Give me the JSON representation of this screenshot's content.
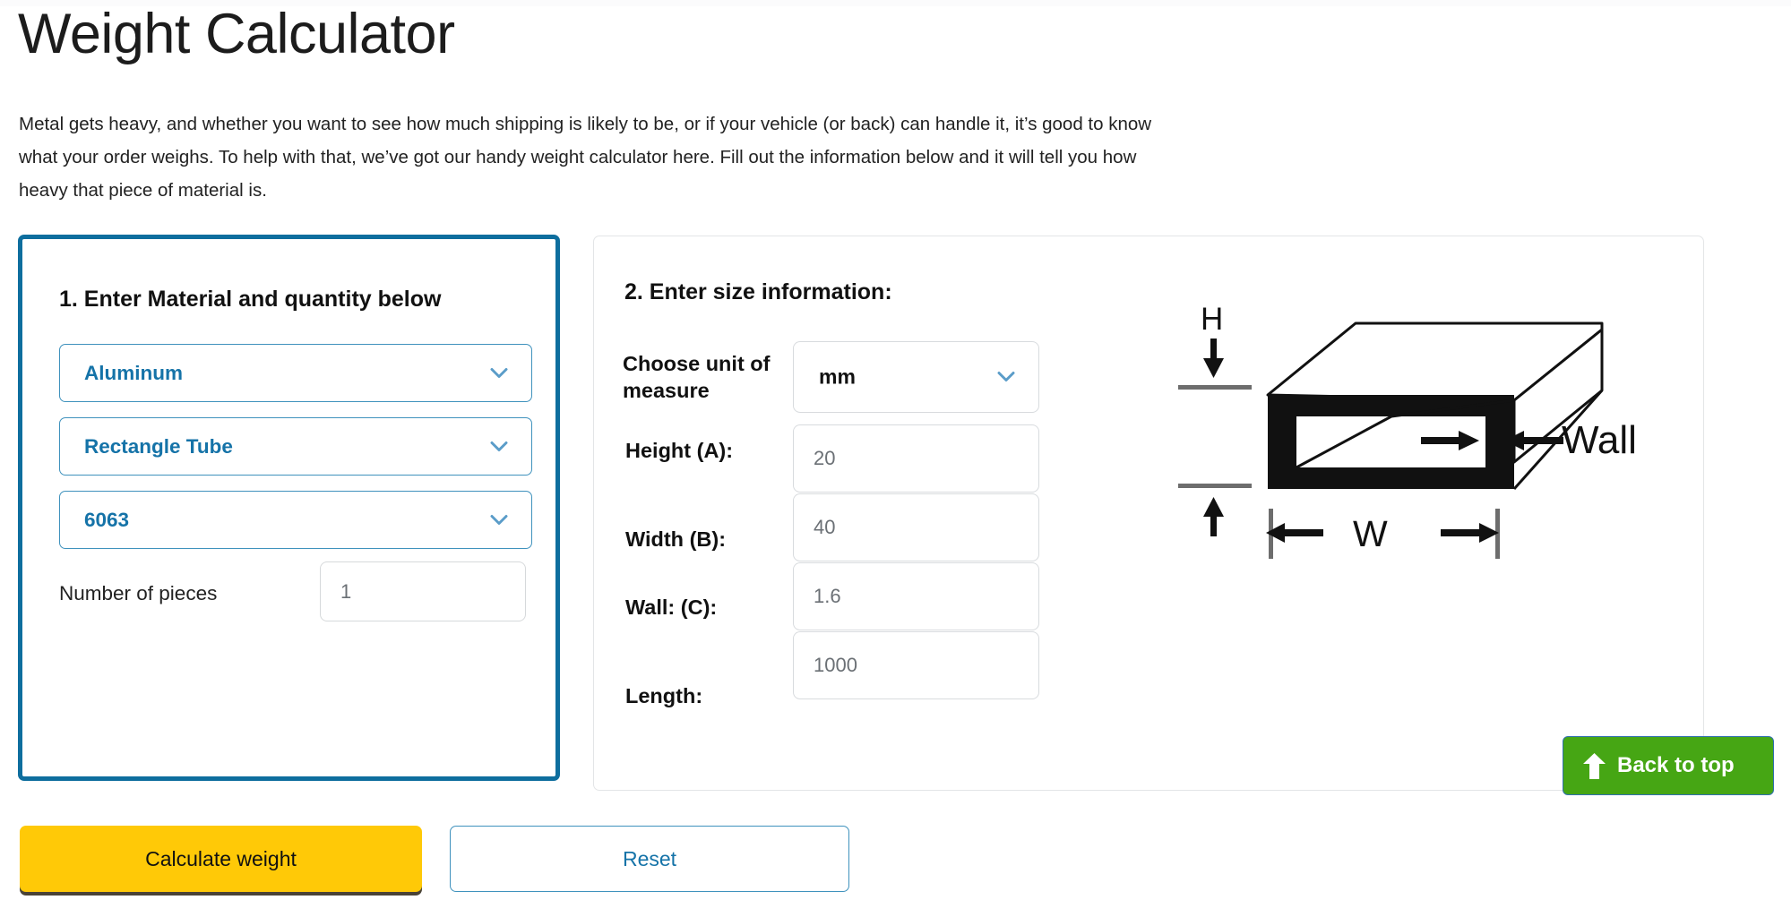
{
  "header": {
    "title": "Weight Calculator",
    "intro": "Metal gets heavy, and whether you want to see how much shipping is likely to be, or if your vehicle (or back) can handle it, it’s good to know what your order weighs. To help with that, we’ve got our handy weight calculator here. Fill out the information below and it will tell you how heavy that piece of material is."
  },
  "material_panel": {
    "title": "1. Enter Material and quantity below",
    "material_select": {
      "label": "Material",
      "value": "Aluminum",
      "icon": "chevron-down-icon"
    },
    "shape_select": {
      "label": "Shape",
      "value": "Rectangle Tube",
      "icon": "chevron-down-icon"
    },
    "grade_select": {
      "label": "Grade",
      "value": "6063",
      "icon": "chevron-down-icon"
    },
    "pieces": {
      "label": "Number of pieces",
      "placeholder": "1",
      "value": ""
    }
  },
  "size_panel": {
    "title": "2. Enter size information:",
    "unit_of_measure": {
      "label": "Choose unit of measure",
      "value": "mm",
      "icon": "chevron-down-icon"
    },
    "fields": [
      {
        "label": "Height (A):",
        "placeholder": "20",
        "value": ""
      },
      {
        "label": "Width (B):",
        "placeholder": "40",
        "value": ""
      },
      {
        "label": "Wall: (C):",
        "placeholder": "1.6",
        "value": ""
      },
      {
        "label": "Length:",
        "placeholder": "1000",
        "value": ""
      }
    ],
    "diagram": {
      "name": "rectangle-tube-diagram",
      "height_label": "H",
      "width_label": "W",
      "wall_label": "Wall"
    }
  },
  "actions": {
    "calculate_label": "Calculate weight",
    "reset_label": "Reset"
  },
  "back_to_top": {
    "label": "Back to top",
    "icon": "arrow-up-icon"
  },
  "colors": {
    "panel_accent_blue": "#0e6e9e",
    "link_blue": "#1573a8",
    "select_border_blue": "#3f92bd",
    "chevron_blue": "#5b9dc9",
    "input_border_gray": "#d8dbde",
    "placeholder_gray": "#6b7075",
    "calculate_yellow": "#ffc907",
    "back_to_top_green": "#46a614",
    "page_background": "#ffffff"
  }
}
